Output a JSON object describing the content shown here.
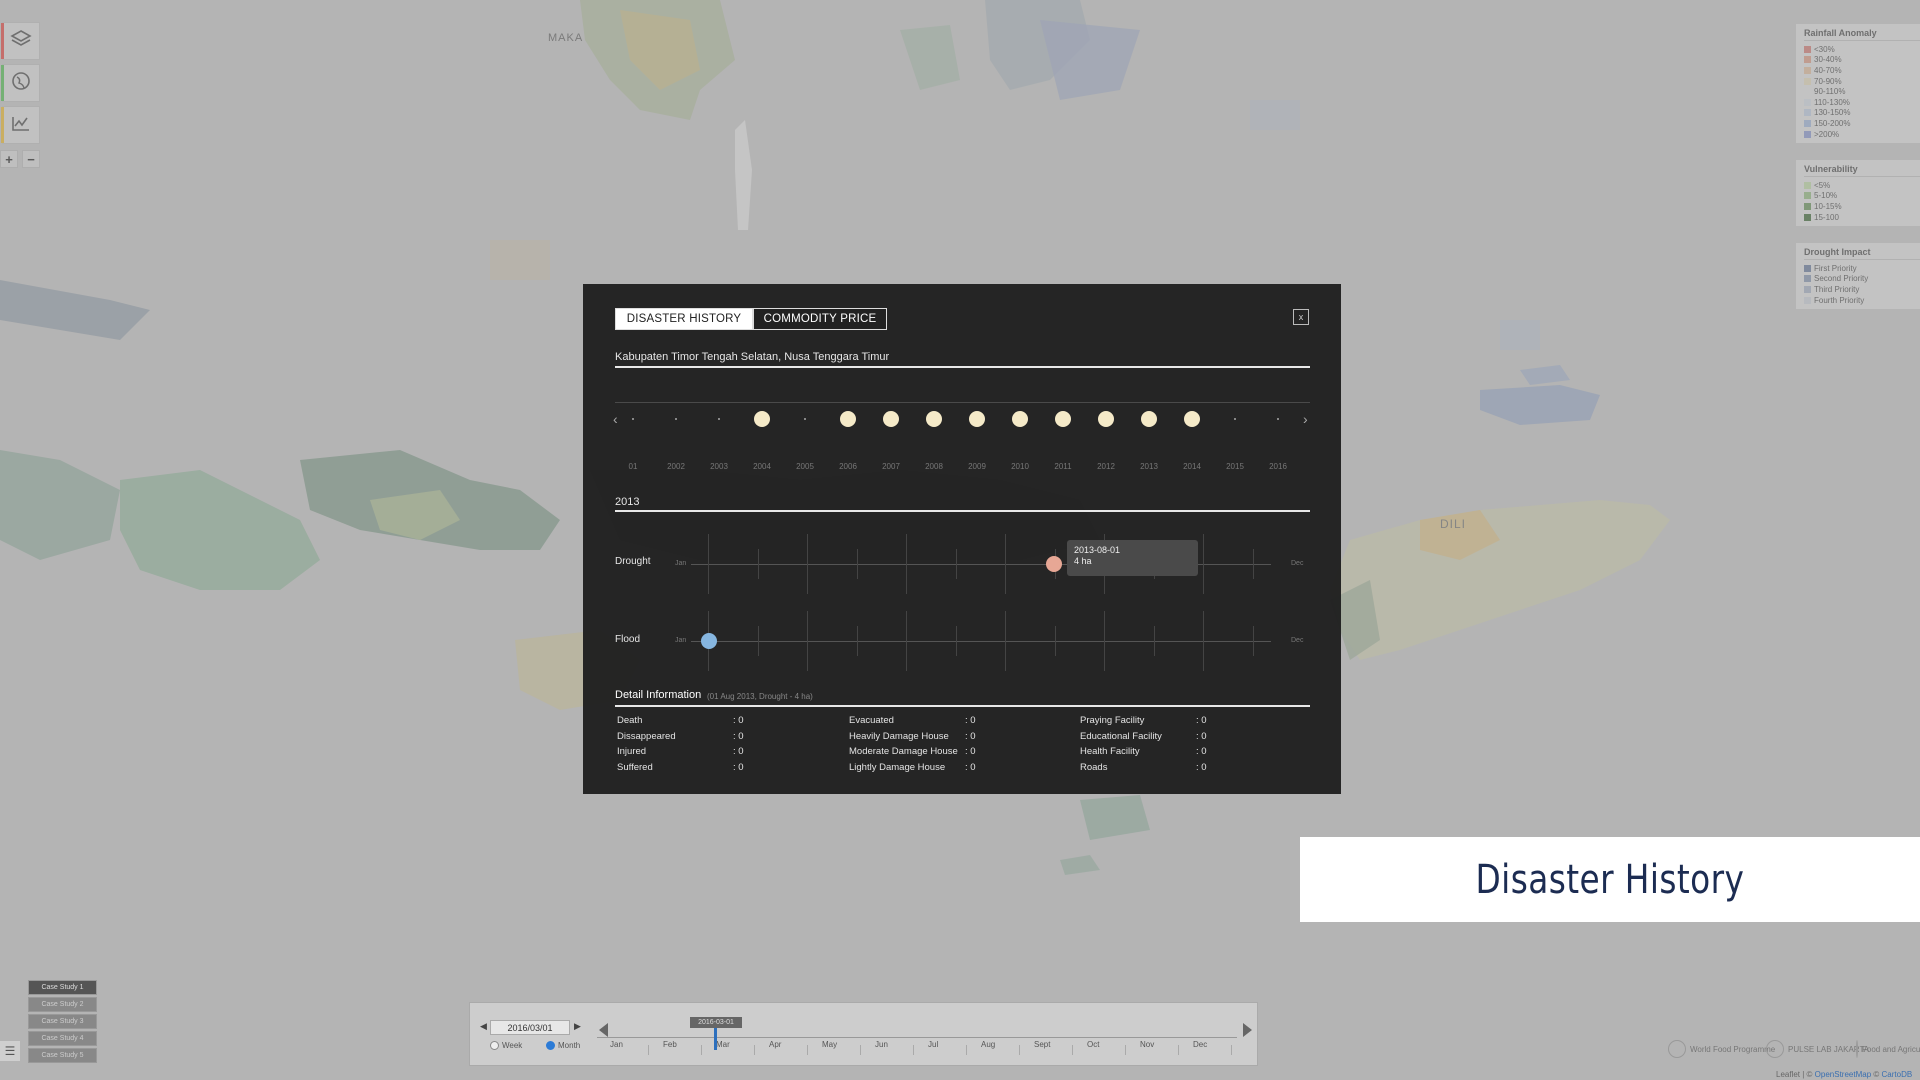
{
  "map": {
    "labels": {
      "makassar": "MAKA",
      "dili": "DILI"
    }
  },
  "controls": {
    "layers_icon": "layers-icon",
    "globe_icon": "globe-icon",
    "chart_icon": "chart-icon",
    "zoom_in": "+",
    "zoom_out": "−"
  },
  "legend": {
    "rainfall": {
      "title": "Rainfall Anomaly",
      "items": [
        {
          "label": "<30%",
          "color": "#c97f79"
        },
        {
          "label": "30-40%",
          "color": "#d19a86"
        },
        {
          "label": "40-70%",
          "color": "#d6b79c"
        },
        {
          "label": "70-90%",
          "color": "#d9d0b5"
        },
        {
          "label": "90-110%",
          "color": "#d6d6d6"
        },
        {
          "label": "110-130%",
          "color": "#c9d0d8"
        },
        {
          "label": "130-150%",
          "color": "#b7c4d6"
        },
        {
          "label": "150-200%",
          "color": "#9fb1cf"
        },
        {
          "label": ">200%",
          "color": "#8b97c7"
        }
      ]
    },
    "vulnerability": {
      "title": "Vulnerability",
      "items": [
        {
          "label": "<5%",
          "color": "#b8cfa4"
        },
        {
          "label": "5-10%",
          "color": "#94b583"
        },
        {
          "label": "10-15%",
          "color": "#6f9463"
        },
        {
          "label": "15-100",
          "color": "#4c7145"
        }
      ]
    },
    "impact": {
      "title": "Drought Impact",
      "items": [
        {
          "label": "First Priority",
          "color": "#6f7f9c"
        },
        {
          "label": "Second Priority",
          "color": "#8896ad"
        },
        {
          "label": "Third Priority",
          "color": "#a3adbd"
        },
        {
          "label": "Fourth Priority",
          "color": "#c3c8d0"
        }
      ]
    }
  },
  "modal": {
    "tabs": [
      {
        "label": "DISASTER HISTORY",
        "active": true
      },
      {
        "label": "COMMODITY PRICE",
        "active": false
      }
    ],
    "close_label": "x",
    "region": "Kabupaten Timor Tengah Selatan, Nusa Tenggara Timur",
    "years": [
      {
        "label": "01",
        "has_event": false
      },
      {
        "label": "2002",
        "has_event": false
      },
      {
        "label": "2003",
        "has_event": false
      },
      {
        "label": "2004",
        "has_event": true
      },
      {
        "label": "2005",
        "has_event": false
      },
      {
        "label": "2006",
        "has_event": true
      },
      {
        "label": "2007",
        "has_event": true
      },
      {
        "label": "2008",
        "has_event": true
      },
      {
        "label": "2009",
        "has_event": true
      },
      {
        "label": "2010",
        "has_event": true
      },
      {
        "label": "2011",
        "has_event": true
      },
      {
        "label": "2012",
        "has_event": true
      },
      {
        "label": "2013",
        "has_event": true
      },
      {
        "label": "2014",
        "has_event": true
      },
      {
        "label": "2015",
        "has_event": false
      },
      {
        "label": "2016",
        "has_event": false
      }
    ],
    "selected_year": "2013",
    "rows": {
      "drought": {
        "label": "Drought",
        "start": "Jan",
        "end": "Dec"
      },
      "flood": {
        "label": "Flood",
        "start": "Jan",
        "end": "Dec"
      }
    },
    "tooltip": {
      "date": "2013-08-01",
      "value": "4 ha"
    },
    "detail": {
      "title": "Detail Information",
      "subtitle": "(01 Aug 2013, Drought - 4 ha)",
      "columns": [
        [
          {
            "label": "Death",
            "value": ": 0"
          },
          {
            "label": "Dissappeared",
            "value": ": 0"
          },
          {
            "label": "Injured",
            "value": ": 0"
          },
          {
            "label": "Suffered",
            "value": ": 0"
          }
        ],
        [
          {
            "label": "Evacuated",
            "value": ": 0"
          },
          {
            "label": "Heavily Damage House",
            "value": ": 0"
          },
          {
            "label": "Moderate Damage House",
            "value": ": 0"
          },
          {
            "label": "Lightly Damage House",
            "value": ": 0"
          }
        ],
        [
          {
            "label": "Praying Facility",
            "value": ": 0"
          },
          {
            "label": "Educational Facility",
            "value": ": 0"
          },
          {
            "label": "Health Facility",
            "value": ": 0"
          },
          {
            "label": "Roads",
            "value": ": 0"
          }
        ]
      ]
    }
  },
  "timeline": {
    "date": "2016/03/01",
    "marker": "2016-03-01",
    "modes": [
      {
        "label": "Week",
        "selected": false
      },
      {
        "label": "Month",
        "selected": true
      }
    ],
    "months": [
      "Jan",
      "Feb",
      "Mar",
      "Apr",
      "May",
      "Jun",
      "Jul",
      "Aug",
      "Sept",
      "Oct",
      "Nov",
      "Dec"
    ]
  },
  "case_studies": [
    {
      "label": "Case Study 1",
      "active": true
    },
    {
      "label": "Case Study 2",
      "active": false
    },
    {
      "label": "Case Study 3",
      "active": false
    },
    {
      "label": "Case Study 4",
      "active": false
    },
    {
      "label": "Case Study 5",
      "active": false
    }
  ],
  "logos": [
    "World Food Programme",
    "PULSE LAB JAKARTA",
    "Food and Agriculture Organization"
  ],
  "attribution": {
    "prefix": "Leaflet | © ",
    "osm": "OpenStreetMap",
    "sep": " © ",
    "carto": "CartoDB"
  },
  "banner": "Disaster History"
}
